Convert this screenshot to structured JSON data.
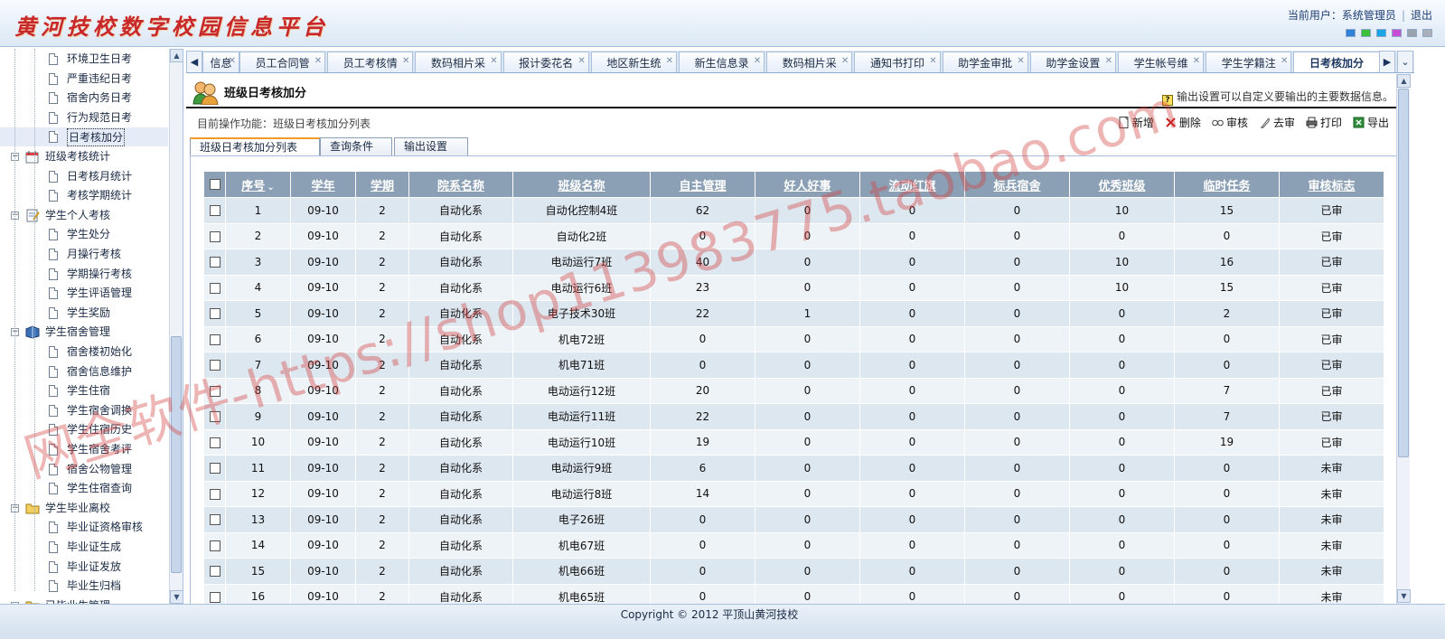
{
  "header": {
    "logo_text": "黄河技校数字校园信息平台",
    "user_label": "当前用户：系统管理员",
    "logout": "退出",
    "theme_colors": [
      "#2f82d8",
      "#3bbf3b",
      "#1aa6e6",
      "#c84dd6",
      "#9aa3ad",
      "#a9b0b8"
    ]
  },
  "sidebar": {
    "items": [
      {
        "label": "环境卫生日考",
        "level": 2,
        "icon": "page-icon"
      },
      {
        "label": "严重违纪日考",
        "level": 2,
        "icon": "page-icon"
      },
      {
        "label": "宿舍内务日考",
        "level": 2,
        "icon": "page-icon"
      },
      {
        "label": "行为规范日考",
        "level": 2,
        "icon": "page-icon"
      },
      {
        "label": "日考核加分",
        "level": 2,
        "icon": "page-icon",
        "selected": true
      },
      {
        "label": "班级考核统计",
        "level": 1,
        "icon": "calendar-icon"
      },
      {
        "label": "日考核月统计",
        "level": 2,
        "icon": "page-icon"
      },
      {
        "label": "考核学期统计",
        "level": 2,
        "icon": "page-icon"
      },
      {
        "label": "学生个人考核",
        "level": 1,
        "icon": "notepad-icon"
      },
      {
        "label": "学生处分",
        "level": 2,
        "icon": "page-icon"
      },
      {
        "label": "月操行考核",
        "level": 2,
        "icon": "page-icon"
      },
      {
        "label": "学期操行考核",
        "level": 2,
        "icon": "page-icon"
      },
      {
        "label": "学生评语管理",
        "level": 2,
        "icon": "page-icon"
      },
      {
        "label": "学生奖励",
        "level": 2,
        "icon": "page-icon"
      },
      {
        "label": "学生宿舍管理",
        "level": 1,
        "icon": "book-icon"
      },
      {
        "label": "宿舍楼初始化",
        "level": 2,
        "icon": "page-icon"
      },
      {
        "label": "宿舍信息维护",
        "level": 2,
        "icon": "page-icon"
      },
      {
        "label": "学生住宿",
        "level": 2,
        "icon": "page-icon"
      },
      {
        "label": "学生宿舍调换",
        "level": 2,
        "icon": "page-icon"
      },
      {
        "label": "学生住宿历史",
        "level": 2,
        "icon": "page-icon"
      },
      {
        "label": "学生宿舍考评",
        "level": 2,
        "icon": "page-icon"
      },
      {
        "label": "宿舍公物管理",
        "level": 2,
        "icon": "page-icon"
      },
      {
        "label": "学生住宿查询",
        "level": 2,
        "icon": "page-icon"
      },
      {
        "label": "学生毕业离校",
        "level": 1,
        "icon": "folder-icon"
      },
      {
        "label": "毕业证资格审核",
        "level": 2,
        "icon": "page-icon"
      },
      {
        "label": "毕业证生成",
        "level": 2,
        "icon": "page-icon"
      },
      {
        "label": "毕业证发放",
        "level": 2,
        "icon": "page-icon"
      },
      {
        "label": "毕业生归档",
        "level": 2,
        "icon": "page-icon"
      },
      {
        "label": "已毕业生管理",
        "level": 1,
        "icon": "folder-icon"
      }
    ]
  },
  "tabs": {
    "nav_left": "◀",
    "nav_right": "▶",
    "nav_menu": "⌄",
    "close": "✕",
    "items": [
      {
        "label": "信息"
      },
      {
        "label": "员工合同管"
      },
      {
        "label": "员工考核情"
      },
      {
        "label": "数码相片采"
      },
      {
        "label": "报计委花名"
      },
      {
        "label": "地区新生统"
      },
      {
        "label": "新生信息录"
      },
      {
        "label": "数码相片采"
      },
      {
        "label": "通知书打印"
      },
      {
        "label": "助学金审批"
      },
      {
        "label": "助学金设置"
      },
      {
        "label": "学生帐号维"
      },
      {
        "label": "学生学籍注"
      },
      {
        "label": "日考核加分",
        "active": true
      }
    ]
  },
  "page": {
    "title": "班级日考核加分",
    "hint": "输出设置可以自定义要输出的主要数据信息。",
    "hint_icon": "?",
    "current_op": "目前操作功能：班级日考核加分列表"
  },
  "toolbar": [
    {
      "label": "新增",
      "icon": "new-icon"
    },
    {
      "label": "删除",
      "icon": "delete-icon"
    },
    {
      "label": "审核",
      "icon": "approve-icon"
    },
    {
      "label": "去审",
      "icon": "unapprove-icon"
    },
    {
      "label": "打印",
      "icon": "print-icon"
    },
    {
      "label": "导出",
      "icon": "export-icon"
    }
  ],
  "subtabs": [
    {
      "label": "班级日考核加分列表",
      "active": true
    },
    {
      "label": "查询条件"
    },
    {
      "label": "输出设置"
    }
  ],
  "table": {
    "columns": [
      "序号",
      "学年",
      "学期",
      "院系名称",
      "班级名称",
      "自主管理",
      "好人好事",
      "流动红旗",
      "标兵宿舍",
      "优秀班级",
      "临时任务",
      "审核标志"
    ],
    "sort_indicator": "⌄",
    "rows": [
      [
        "1",
        "09-10",
        "2",
        "自动化系",
        "自动化控制4班",
        "62",
        "0",
        "0",
        "0",
        "10",
        "15",
        "已审"
      ],
      [
        "2",
        "09-10",
        "2",
        "自动化系",
        "自动化2班",
        "0",
        "0",
        "0",
        "0",
        "0",
        "0",
        "已审"
      ],
      [
        "3",
        "09-10",
        "2",
        "自动化系",
        "电动运行7班",
        "40",
        "0",
        "0",
        "0",
        "10",
        "16",
        "已审"
      ],
      [
        "4",
        "09-10",
        "2",
        "自动化系",
        "电动运行6班",
        "23",
        "0",
        "0",
        "0",
        "10",
        "15",
        "已审"
      ],
      [
        "5",
        "09-10",
        "2",
        "自动化系",
        "电子技术30班",
        "22",
        "1",
        "0",
        "0",
        "0",
        "2",
        "已审"
      ],
      [
        "6",
        "09-10",
        "2",
        "自动化系",
        "机电72班",
        "0",
        "0",
        "0",
        "0",
        "0",
        "0",
        "已审"
      ],
      [
        "7",
        "09-10",
        "2",
        "自动化系",
        "机电71班",
        "0",
        "0",
        "0",
        "0",
        "0",
        "0",
        "已审"
      ],
      [
        "8",
        "09-10",
        "2",
        "自动化系",
        "电动运行12班",
        "20",
        "0",
        "0",
        "0",
        "0",
        "7",
        "已审"
      ],
      [
        "9",
        "09-10",
        "2",
        "自动化系",
        "电动运行11班",
        "22",
        "0",
        "0",
        "0",
        "0",
        "7",
        "已审"
      ],
      [
        "10",
        "09-10",
        "2",
        "自动化系",
        "电动运行10班",
        "19",
        "0",
        "0",
        "0",
        "0",
        "19",
        "已审"
      ],
      [
        "11",
        "09-10",
        "2",
        "自动化系",
        "电动运行9班",
        "6",
        "0",
        "0",
        "0",
        "0",
        "0",
        "未审"
      ],
      [
        "12",
        "09-10",
        "2",
        "自动化系",
        "电动运行8班",
        "14",
        "0",
        "0",
        "0",
        "0",
        "0",
        "未审"
      ],
      [
        "13",
        "09-10",
        "2",
        "自动化系",
        "电子26班",
        "0",
        "0",
        "0",
        "0",
        "0",
        "0",
        "未审"
      ],
      [
        "14",
        "09-10",
        "2",
        "自动化系",
        "机电67班",
        "0",
        "0",
        "0",
        "0",
        "0",
        "0",
        "未审"
      ],
      [
        "15",
        "09-10",
        "2",
        "自动化系",
        "机电66班",
        "0",
        "0",
        "0",
        "0",
        "0",
        "0",
        "未审"
      ],
      [
        "16",
        "09-10",
        "2",
        "自动化系",
        "机电65班",
        "0",
        "0",
        "0",
        "0",
        "0",
        "0",
        "未审"
      ]
    ]
  },
  "footer": "Copyright © 2012 平顶山黄河技校",
  "watermark": "网全软件-https://shop113983775.taobao.com",
  "colors": {
    "approved": "#d40000",
    "pending": "#0000cc",
    "header_bg": "#8ba0b4",
    "row_odd": "#dde7ef",
    "row_even": "#eef3f7"
  }
}
